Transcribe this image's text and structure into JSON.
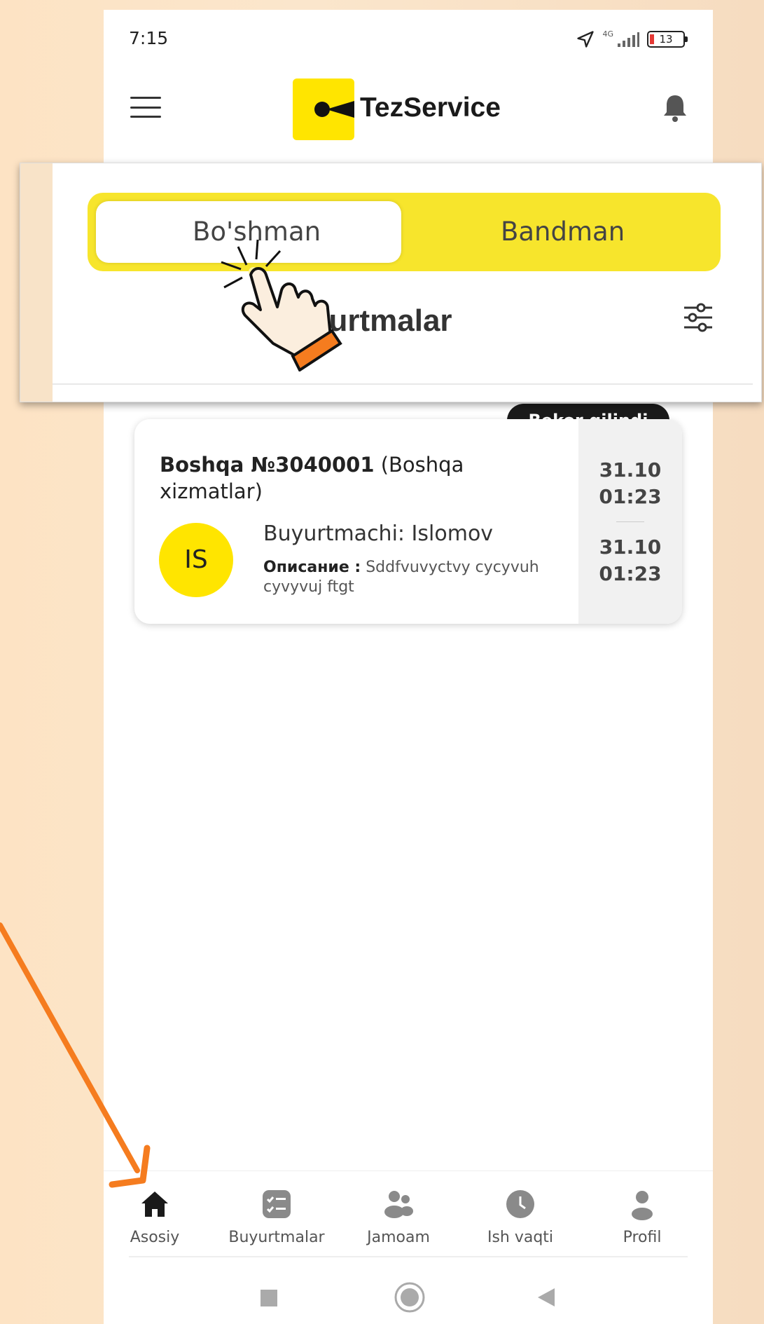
{
  "status_bar": {
    "time": "7:15",
    "network": "4G",
    "battery": "13"
  },
  "header": {
    "app_name": "TezService",
    "brand_color": "#ffe500"
  },
  "callout": {
    "toggle": {
      "options": [
        "Bo'shman",
        "Bandman"
      ],
      "selected": "Bo'shman"
    },
    "section_title": "yurtmalar"
  },
  "order": {
    "status_badge": "Bekor qilindi",
    "number": "Boshqa №3040001",
    "category": "(Boshqa xizmatlar)",
    "avatar_initials": "IS",
    "customer": "Buyurtmachi: Islomov",
    "description_label": "Описание :",
    "description_text": "Sddfvuvyctvy cycyvuh cyvyvuj ftgt",
    "date_start": "31.10",
    "time_start": "01:23",
    "date_end": "31.10",
    "time_end": "01:23"
  },
  "bottom_nav": {
    "items": [
      {
        "label": "Asosiy",
        "icon": "home-icon",
        "active": true
      },
      {
        "label": "Buyurtmalar",
        "icon": "checklist-icon",
        "active": false
      },
      {
        "label": "Jamoam",
        "icon": "team-icon",
        "active": false
      },
      {
        "label": "Ish vaqti",
        "icon": "clock-icon",
        "active": false
      },
      {
        "label": "Profil",
        "icon": "profile-icon",
        "active": false
      }
    ]
  },
  "annotation": {
    "arrow_color": "#f57c1f",
    "hand_cuff_color": "#f57c1f"
  }
}
